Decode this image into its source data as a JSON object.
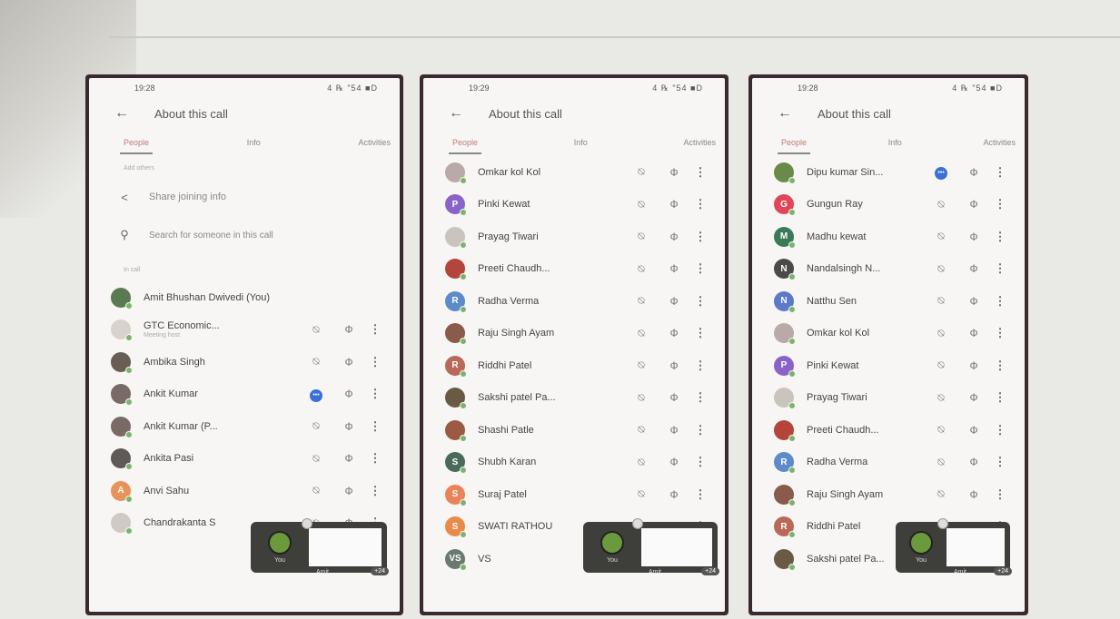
{
  "colors": {
    "accent": "#c07b7b",
    "bg": "#f7f6f4",
    "speaking": "#3b6fd8",
    "online": "#7bb36e"
  },
  "phones": [
    {
      "status": {
        "time": "19:28",
        "icons": "4 ℞ \"54 ■D"
      },
      "title": "About this call",
      "tabs": [
        "People",
        "Info",
        "Activities"
      ],
      "add_label": "Add others",
      "share_label": "Share joining info",
      "search_placeholder": "Search for someone in this call",
      "incall_label": "In call",
      "participants": [
        {
          "name": "Amit Bhushan Dwivedi (You)",
          "sub": "",
          "initial": "",
          "color": "#5a7a52",
          "self": true
        },
        {
          "name": "GTC Economic...",
          "sub": "Meeting host",
          "initial": "",
          "color": "#d8d2cc"
        },
        {
          "name": "Ambika Singh",
          "sub": "",
          "initial": "",
          "color": "#6a5d54"
        },
        {
          "name": "Ankit Kumar",
          "sub": "",
          "initial": "",
          "color": "#7a6a66",
          "speaking": true
        },
        {
          "name": "Ankit Kumar (P...",
          "sub": "",
          "initial": "",
          "color": "#7a6a66"
        },
        {
          "name": "Ankita Pasi",
          "sub": "",
          "initial": "",
          "color": "#615858"
        },
        {
          "name": "Anvi Sahu",
          "sub": "",
          "initial": "A",
          "color": "#e9935a"
        },
        {
          "name": "Chandrakanta S",
          "sub": "",
          "initial": "",
          "color": "#cfcac4"
        }
      ]
    },
    {
      "status": {
        "time": "19:29",
        "icons": "4 ℞ \"54 ■D"
      },
      "title": "About this call",
      "tabs": [
        "People",
        "Info",
        "Activities"
      ],
      "participants": [
        {
          "name": "Omkar kol Kol",
          "initial": "",
          "color": "#b9a9a8"
        },
        {
          "name": "Pinki Kewat",
          "initial": "P",
          "color": "#8a63c9"
        },
        {
          "name": "Prayag Tiwari",
          "initial": "",
          "color": "#c9c4be"
        },
        {
          "name": "Preeti Chaudh...",
          "initial": "",
          "color": "#b4453a"
        },
        {
          "name": "Radha Verma",
          "initial": "R",
          "color": "#5d8ac9"
        },
        {
          "name": "Raju Singh Ayam",
          "initial": "",
          "color": "#8a5a4a"
        },
        {
          "name": "Riddhi Patel",
          "initial": "R",
          "color": "#b9685a"
        },
        {
          "name": "Sakshi patel Pa...",
          "initial": "",
          "color": "#6a5a44"
        },
        {
          "name": "Shashi Patle",
          "initial": "",
          "color": "#9a5a44"
        },
        {
          "name": "Shubh Karan",
          "initial": "S",
          "color": "#4a6a5a"
        },
        {
          "name": "Suraj Patel",
          "initial": "S",
          "color": "#e9835a"
        },
        {
          "name": "SWATI RATHOU",
          "initial": "S",
          "color": "#e98a4a"
        },
        {
          "name": "VS",
          "initial": "VS",
          "color": "#6a7a70"
        }
      ]
    },
    {
      "status": {
        "time": "19:28",
        "icons": "4 ℞ \"54 ■D"
      },
      "title": "About this call",
      "tabs": [
        "People",
        "Info",
        "Activities"
      ],
      "participants": [
        {
          "name": "Dipu kumar Sin...",
          "initial": "",
          "color": "#6a8a4a",
          "speaking": true
        },
        {
          "name": "Gungun Ray",
          "initial": "G",
          "color": "#e0455a"
        },
        {
          "name": "Madhu kewat",
          "initial": "M",
          "color": "#3a7a5a"
        },
        {
          "name": "Nandalsingh N...",
          "initial": "N",
          "color": "#4a4a4a"
        },
        {
          "name": "Natthu Sen",
          "initial": "N",
          "color": "#5d7ac9"
        },
        {
          "name": "Omkar kol Kol",
          "initial": "",
          "color": "#b9a9a8"
        },
        {
          "name": "Pinki Kewat",
          "initial": "P",
          "color": "#8a63c9"
        },
        {
          "name": "Prayag Tiwari",
          "initial": "",
          "color": "#c9c4be"
        },
        {
          "name": "Preeti Chaudh...",
          "initial": "",
          "color": "#b4453a"
        },
        {
          "name": "Radha Verma",
          "initial": "R",
          "color": "#5d8ac9"
        },
        {
          "name": "Raju Singh Ayam",
          "initial": "",
          "color": "#8a5a4a"
        },
        {
          "name": "Riddhi Patel",
          "initial": "R",
          "color": "#b9685a"
        },
        {
          "name": "Sakshi patel Pa...",
          "initial": "",
          "color": "#6a5a44"
        }
      ]
    }
  ],
  "pip": {
    "you_label": "You",
    "tile_label": "Amit",
    "count": "+24"
  },
  "icons": {
    "mic_off": "mic-off-icon",
    "pin": "pin-icon",
    "more": "more-vert-icon",
    "back": "arrow-back-icon",
    "share": "share-icon",
    "search": "search-icon"
  }
}
